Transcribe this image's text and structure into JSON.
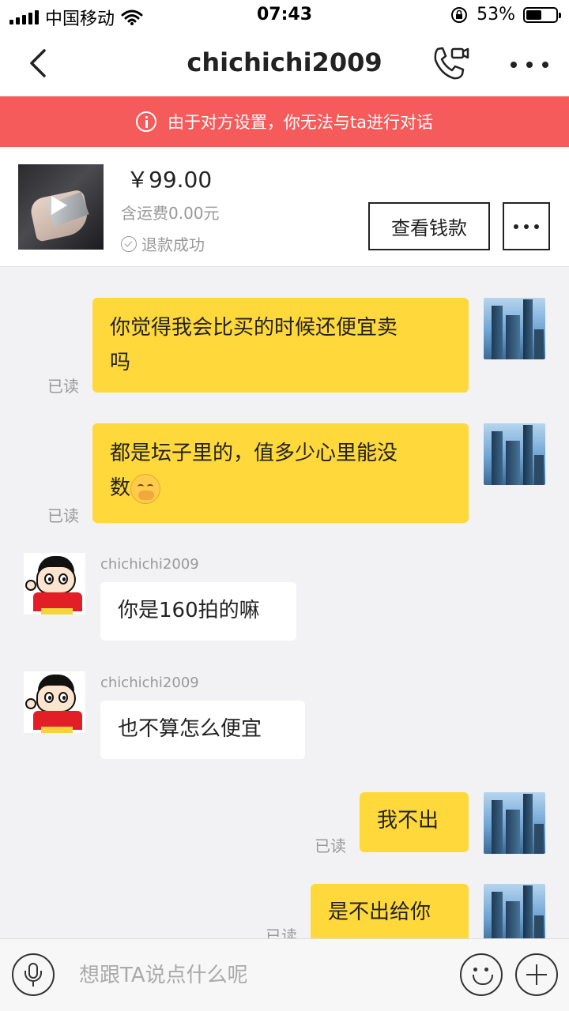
{
  "status_bar": {
    "carrier": "中国移动",
    "time": "07:43",
    "battery_percent": "53%",
    "battery_level": 0.53
  },
  "nav": {
    "title": "chichichi2009"
  },
  "banner": {
    "text": "由于对方设置，你无法与ta进行对话",
    "color": "#f65b5b"
  },
  "product": {
    "price": "￥99.00",
    "shipping": "含运费0.00元",
    "status": "退款成功",
    "view_money_label": "查看钱款"
  },
  "messages": [
    {
      "from": "me",
      "text_line1": "你觉得我会比买的时候还便宜卖",
      "text_line2": "吗",
      "read": "已读"
    },
    {
      "from": "me",
      "text_line1": "都是坛子里的，值多少心里能没",
      "text_line2": "数",
      "read": "已读",
      "emoji": "face-with-hand-over-mouth-emoji"
    },
    {
      "from": "other",
      "sender": "chichichi2009",
      "text": "你是160拍的嘛"
    },
    {
      "from": "other",
      "sender": "chichichi2009",
      "text": "也不算怎么便宜"
    },
    {
      "from": "me",
      "text": "我不出",
      "read": "已读"
    },
    {
      "from": "me",
      "text": "是不出给你",
      "read": "已读"
    }
  ],
  "input": {
    "placeholder": "想跟TA说点什么呢"
  },
  "colors": {
    "my_bubble": "#ffd83b",
    "other_bubble": "#ffffff",
    "background": "#f2f2f5"
  }
}
